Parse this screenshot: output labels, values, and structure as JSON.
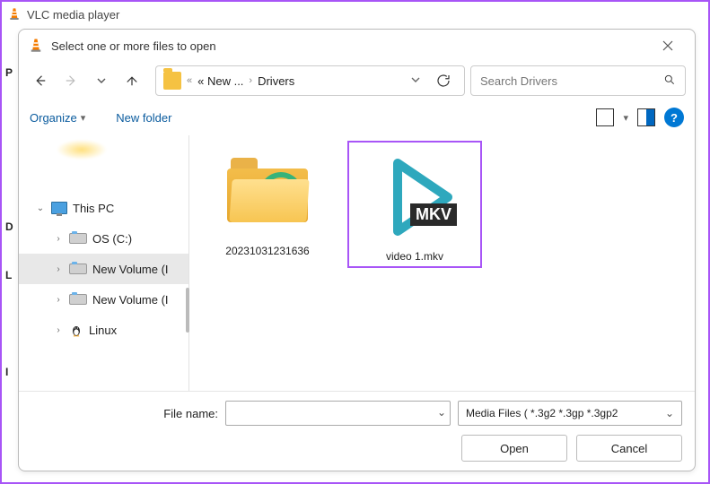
{
  "parent_window": {
    "title": "VLC media player"
  },
  "left_letters": [
    "P",
    "D",
    "L",
    "I"
  ],
  "dialog": {
    "title": "Select one or more files to open",
    "breadcrumb": {
      "ellipsis": "« New ...",
      "current": "Drivers"
    },
    "search": {
      "placeholder": "Search Drivers"
    },
    "toolbar": {
      "organize": "Organize",
      "new_folder": "New folder"
    },
    "sidebar": {
      "thispc": "This PC",
      "items": [
        {
          "label": "OS (C:)"
        },
        {
          "label": "New Volume (I"
        },
        {
          "label": "New Volume (I"
        },
        {
          "label": "Linux"
        }
      ]
    },
    "files": [
      {
        "name": "20231031231636",
        "kind": "folder"
      },
      {
        "name": "video 1.mkv",
        "kind": "mkv",
        "badge": "MKV"
      }
    ],
    "filename_label": "File name:",
    "filter": "Media Files ( *.3g2 *.3gp *.3gp2",
    "buttons": {
      "open": "Open",
      "cancel": "Cancel"
    }
  }
}
